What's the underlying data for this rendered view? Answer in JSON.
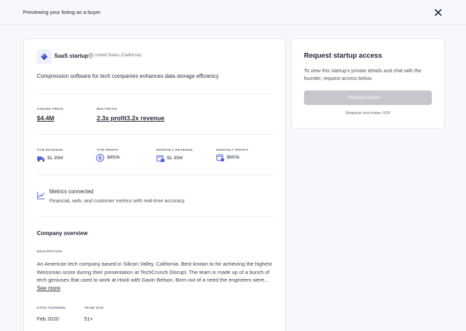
{
  "topbar": {
    "preview_text": "Previewing your listing as a buyer",
    "close_icon": "close-icon"
  },
  "listing": {
    "company_name": "SaaS startup",
    "location": "United States (California)",
    "tagline": "Compression software for tech companies enhances data storage efficiency",
    "asking_price_label": "ASKING PRICE",
    "asking_price": "$4.4M",
    "multiples_label": "MULTIPLES",
    "profit_multiple": "2.3x profit",
    "revenue_multiple": "3.2x revenue",
    "metrics": [
      {
        "label": "TTM REVENUE",
        "value": "$1.35M",
        "icon": "truck-revenue-icon"
      },
      {
        "label": "TTM PROFIT",
        "value": "$850k",
        "icon": "dollar-circle-icon"
      },
      {
        "label": "MONTHLY REVENUE",
        "value": "$1.35M",
        "icon": "calendar-revenue-icon"
      },
      {
        "label": "MONTHLY PROFIT",
        "value": "$850k",
        "icon": "calendar-profit-icon"
      }
    ],
    "metrics_connected": {
      "title": "Metrics connected",
      "subtitle": "Financial, web, and customer metrics with real-time accuracy."
    },
    "overview": {
      "title": "Company overview",
      "description_label": "DESCRIPTION",
      "description": "An American tech company based in Silicon Valley, California. Best known to for achieving the highest Weissman score during their presentation at TechCrunch Disrupt. The team is made up of a bunch of tech geniuses that used to work at Hooli with Gavin Belson. Born out of a need the engineers were...",
      "see_more": "See more",
      "date_founded_label": "DATE FOUNDED",
      "date_founded": "Feb 2020",
      "team_size_label": "TEAM SIZE",
      "team_size": "51+"
    }
  },
  "request": {
    "title": "Request startup access",
    "text": "To view this startup's private details and chat with the founder, request access below.",
    "button_label": "Request access",
    "button_arrow": "→",
    "count_text": "Requests sent today: 0/20"
  },
  "colors": {
    "accent": "#4f5fd6",
    "disabled_button": "#c5c7cd",
    "background": "#f7f8fc"
  }
}
